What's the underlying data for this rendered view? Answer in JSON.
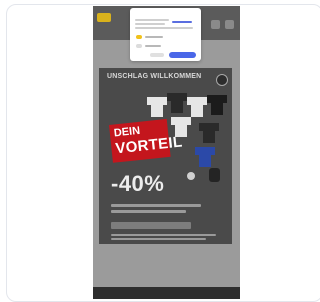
{
  "banner": {
    "title": "UNSCHLAG WILLKOMMEN",
    "subtitle": "",
    "promo": {
      "line1": "DEIN",
      "line2": "VORTEIL",
      "offer": "",
      "discount": "-40%"
    }
  },
  "cookie_dialog": {
    "title": ""
  },
  "colors": {
    "promo_red": "#c4161d",
    "accept_blue": "#4a67e8",
    "toggle_yellow": "#f1c21b",
    "overlay_grey": "#9b9b9b"
  },
  "icons": [
    "club-crest-icon",
    "brand-logo-icon",
    "menu-icon",
    "cart-icon"
  ]
}
